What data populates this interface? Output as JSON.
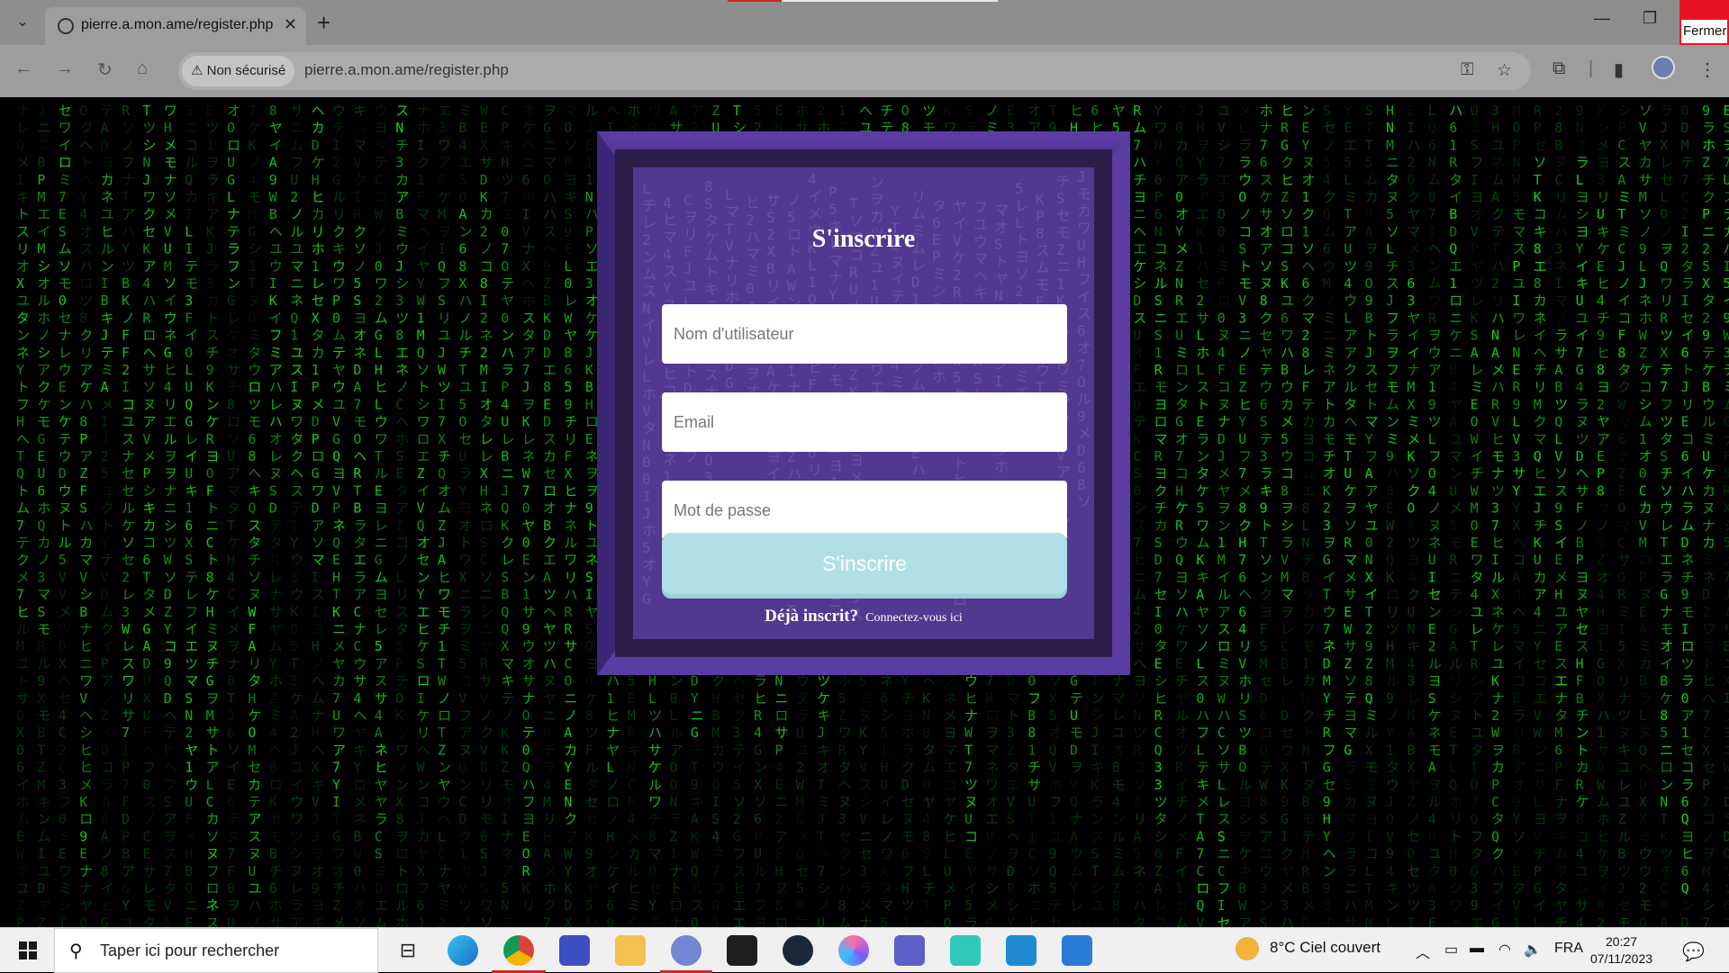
{
  "browser": {
    "tab_title": "pierre.a.mon.ame/register.php",
    "security_label": "Non sécurisé",
    "url": "pierre.a.mon.ame/register.php",
    "close_tooltip": "Fermer"
  },
  "form": {
    "title": "S'inscrire",
    "username_placeholder": "Nom d'utilisateur",
    "email_placeholder": "Email",
    "password_placeholder": "Mot de passe",
    "submit_label": "S'inscrire",
    "already_text": "Déjà inscrit?",
    "login_link": "Connectez-vous ici"
  },
  "taskbar": {
    "search_placeholder": "Taper ici pour rechercher",
    "weather": "8°C  Ciel couvert",
    "language": "FRA",
    "time": "20:27",
    "date": "07/11/2023",
    "apps": [
      "task-view",
      "edge",
      "chrome",
      "vscode-remote",
      "file-explorer",
      "discord",
      "epic-games",
      "steam",
      "krita",
      "teams",
      "xbox-bar",
      "vscode",
      "mail"
    ]
  },
  "colors": {
    "matrix_green": "#19d219",
    "card_purple": "#4a2f8c",
    "button_cyan": "#b0e0e6"
  }
}
